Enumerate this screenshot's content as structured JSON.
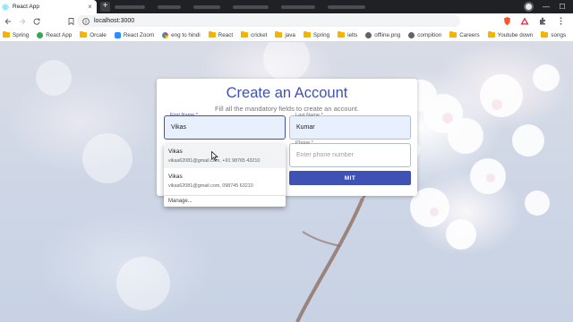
{
  "browser": {
    "tab_title": "React App",
    "tab_close": "×",
    "new_tab": "+",
    "url": "localhost:3000"
  },
  "bookmarks": [
    {
      "label": "Spring",
      "icon": "folder-icon"
    },
    {
      "label": "React App",
      "icon": "globe-icon"
    },
    {
      "label": "Orcale",
      "icon": "folder-icon"
    },
    {
      "label": "React Zoom",
      "icon": "zoom-icon"
    },
    {
      "label": "eng to hindi",
      "icon": "google-icon"
    },
    {
      "label": "React",
      "icon": "folder-icon"
    },
    {
      "label": "cricket",
      "icon": "folder-icon"
    },
    {
      "label": "java",
      "icon": "folder-icon"
    },
    {
      "label": "Spring",
      "icon": "folder-icon"
    },
    {
      "label": "ielts",
      "icon": "folder-icon"
    },
    {
      "label": "offline.png",
      "icon": "globe-icon"
    },
    {
      "label": "compition",
      "icon": "globe-icon"
    },
    {
      "label": "Careers",
      "icon": "folder-icon"
    },
    {
      "label": "Youtube down",
      "icon": "folder-icon"
    },
    {
      "label": "songs",
      "icon": "folder-icon"
    }
  ],
  "form": {
    "title": "Create an Account",
    "subtitle": "Fill all the mandatory fields to create an account.",
    "first_name": {
      "label": "First Name *",
      "value": "Vikas"
    },
    "last_name": {
      "label": "Last Name *",
      "value": "Kumar"
    },
    "phone": {
      "label": "Phone *",
      "placeholder": "Enter phone number"
    },
    "submit_label": "MIT"
  },
  "autofill": {
    "suggestions": [
      {
        "name": "Vikas",
        "detail": "vikas62081@gmail.com, +91 98765 43210"
      },
      {
        "name": "Vikas",
        "detail": "vikas62081@gmail.com, 098745 63210"
      }
    ],
    "manage_label": "Manage..."
  },
  "colors": {
    "primary": "#3f51b5",
    "field_fill": "#e8f0fe"
  }
}
